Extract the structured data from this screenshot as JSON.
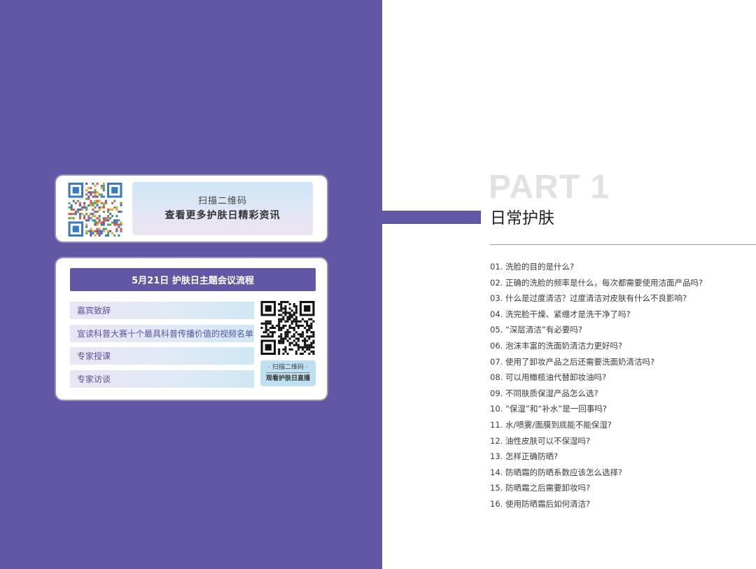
{
  "colors": {
    "primary": "#6157a4",
    "part_gray": "#e2e2e2"
  },
  "scan_card": {
    "qr_icon": "qr-code-icon",
    "line1": "扫描二维码",
    "line2": "查看更多护肤日精彩资讯"
  },
  "agenda": {
    "title": "5月21日  护肤日主题会议流程",
    "items": [
      "嘉宾致辞",
      "宣读科普大赛十个最具科普传播价值的视频名单",
      "专家授课",
      "专家访谈"
    ],
    "qr_icon": "qr-code-icon",
    "live_line1": "· 扫描二维码 ·",
    "live_line2": "观看护肤日直播"
  },
  "part": {
    "label": "PART 1",
    "title": "日常护肤"
  },
  "questions": [
    "01. 洗脸的目的是什么?",
    "02. 正确的洗脸的频率是什么，每次都需要使用洁面产品吗?",
    "03. 什么是过度清洁？过度清洁对皮肤有什么不良影响?",
    "04. 洗完脸干燥、紧绷才是洗干净了吗?",
    "05. “深层清洁”有必要吗?",
    "06. 泡沫丰富的洗面奶清洁力更好吗?",
    "07. 使用了卸妆产品之后还需要洗面奶清洁吗?",
    "08. 可以用橄榄油代替卸妆油吗?",
    "09. 不同肤质保湿产品怎么选?",
    "10. “保湿”和“补水”是一回事吗?",
    "11. 水/喷雾/面膜到底能不能保湿?",
    "12. 油性皮肤可以不保湿吗?",
    "13. 怎样正确防晒?",
    "14. 防晒霜的防晒系数应该怎么选择?",
    "15. 防晒霜之后需要卸妆吗?",
    "16. 使用防晒霜后如何清洁?"
  ]
}
